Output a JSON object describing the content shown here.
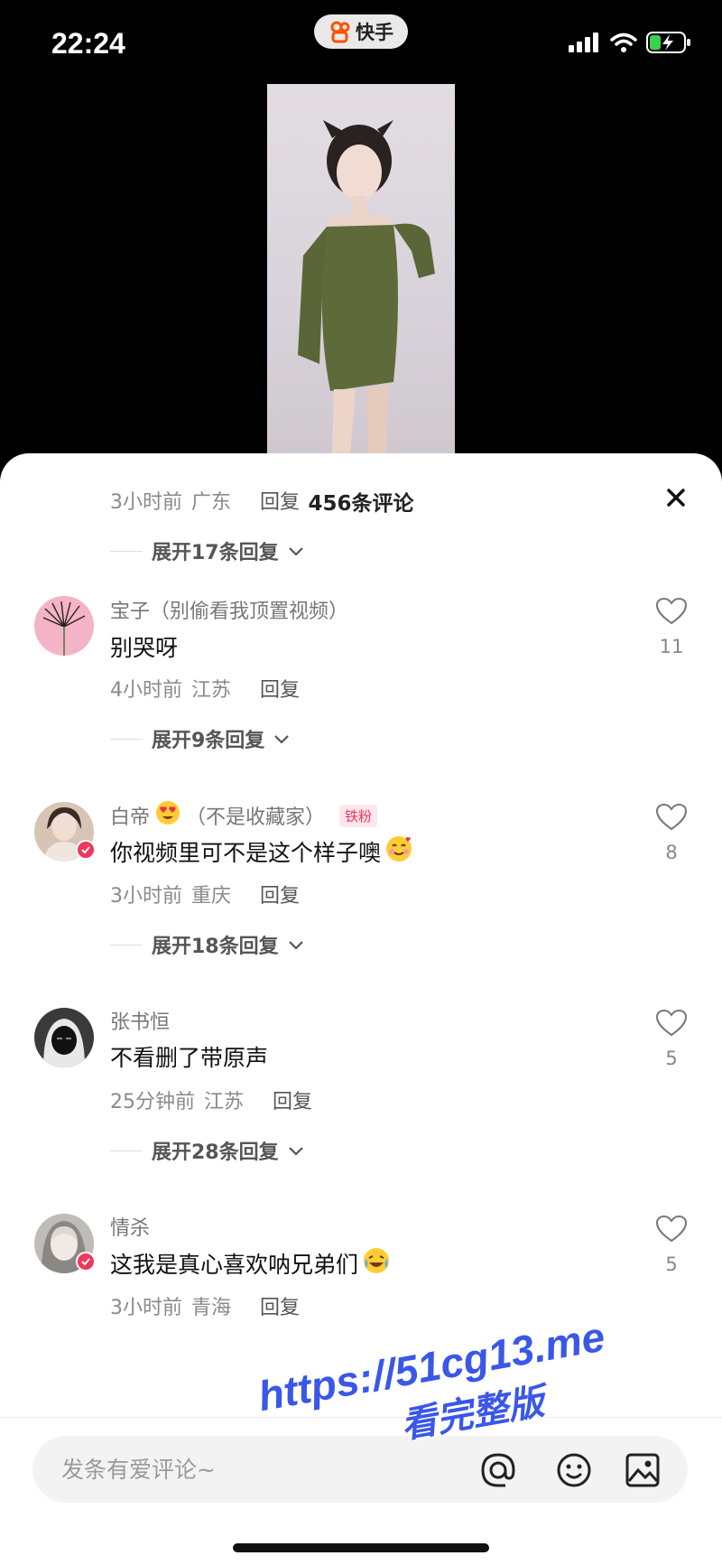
{
  "status_bar": {
    "time": "22:24"
  },
  "app_pill": {
    "name": "快手"
  },
  "sheet": {
    "title": "456条评论"
  },
  "comments_top": {
    "time": "3小时前",
    "location": "广东",
    "reply_label": "回复",
    "expand_label": "展开17条回复"
  },
  "comments": [
    {
      "username": "宝子（别偷看我顶置视频）",
      "text": "别哭呀",
      "likes": "11",
      "time": "4小时前",
      "location": "江苏",
      "reply_label": "回复",
      "expand_label": "展开9条回复"
    },
    {
      "username": "白帝",
      "username_suffix": "（不是收藏家）",
      "fan_badge": "铁粉",
      "text": "你视频里可不是这个样子噢",
      "likes": "8",
      "time": "3小时前",
      "location": "重庆",
      "reply_label": "回复",
      "expand_label": "展开18条回复"
    },
    {
      "username": "张书恒",
      "text": "不看删了带原声",
      "likes": "5",
      "time": "25分钟前",
      "location": "江苏",
      "reply_label": "回复",
      "expand_label": "展开28条回复"
    },
    {
      "username": "情杀",
      "text": "这我是真心喜欢呐兄弟们",
      "likes": "5",
      "time": "3小时前",
      "location": "青海",
      "reply_label": "回复"
    }
  ],
  "input": {
    "placeholder": "发条有爱评论~"
  },
  "watermark": {
    "url": "https://51cg13.me",
    "text": "看完整版"
  },
  "icons": [
    "kuaishou-logo-icon",
    "signal-icon",
    "wifi-icon",
    "battery-charging-icon",
    "close-icon",
    "heart-outline-icon",
    "chevron-down-icon",
    "at-icon",
    "emoji-icon",
    "image-icon",
    "verified-badge-icon"
  ],
  "colors": {
    "accent": "#f2355b",
    "watermark": "#3a57e8",
    "sheet_bg": "#ffffff"
  }
}
